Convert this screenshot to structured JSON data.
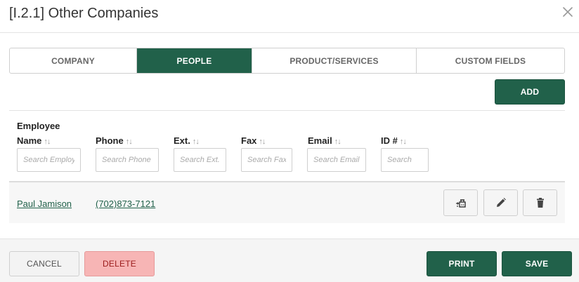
{
  "dialog": {
    "title": "[I.2.1] Other Companies",
    "close_icon": "close-icon"
  },
  "tabs": [
    {
      "label": "COMPANY",
      "active": false
    },
    {
      "label": "PEOPLE",
      "active": true
    },
    {
      "label": "PRODUCT/SERVICES",
      "active": false
    },
    {
      "label": "CUSTOM FIELDS",
      "active": false
    }
  ],
  "toolbar": {
    "add_label": "ADD"
  },
  "table": {
    "columns": [
      {
        "label_line1": "Employee",
        "label_line2": "Name",
        "sort": "↑↓",
        "placeholder": "Search Employee Name"
      },
      {
        "label_line1": "",
        "label_line2": "Phone",
        "sort": "↑↓",
        "placeholder": "Search Phone"
      },
      {
        "label_line1": "",
        "label_line2": "Ext.",
        "sort": "↑↓",
        "placeholder": "Search Ext."
      },
      {
        "label_line1": "",
        "label_line2": "Fax",
        "sort": "↑↓",
        "placeholder": "Search Fax"
      },
      {
        "label_line1": "",
        "label_line2": "Email",
        "sort": "↑↓",
        "placeholder": "Search Email"
      },
      {
        "label_line1": "",
        "label_line2": "ID #",
        "sort": "↑↓",
        "placeholder": "Search"
      }
    ],
    "rows": [
      {
        "name": "Paul Jamison",
        "phone": "(702)873-7121",
        "actions": [
          "transfer-icon",
          "pencil-icon",
          "trash-icon"
        ]
      }
    ]
  },
  "footer": {
    "cancel_label": "CANCEL",
    "delete_label": "DELETE",
    "print_label": "PRINT",
    "save_label": "SAVE"
  },
  "colors": {
    "primary": "#21614a",
    "danger_bg": "#f7b5b5",
    "danger_text": "#9b1c1c"
  }
}
